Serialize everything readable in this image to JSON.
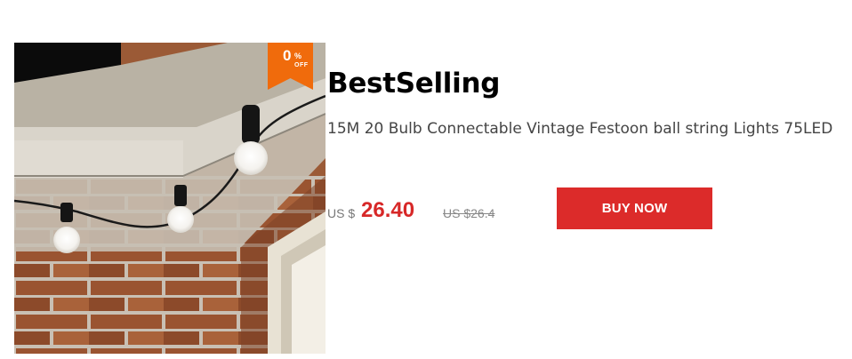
{
  "product": {
    "image_description_icon": "festoon-lights-photo-icon",
    "badge": {
      "value": "0",
      "percent": "%",
      "off": "OFF"
    },
    "heading": "BestSelling",
    "title": "15M 20 Bulb Connectable Vintage Festoon ball string Lights 75LED",
    "currency": "US $",
    "price": "26.40",
    "old_price": "US $26.4",
    "buy_label": "BUY NOW"
  },
  "colors": {
    "price": "#d72828",
    "button": "#dc2b2a",
    "badge": "#f06b0c"
  }
}
